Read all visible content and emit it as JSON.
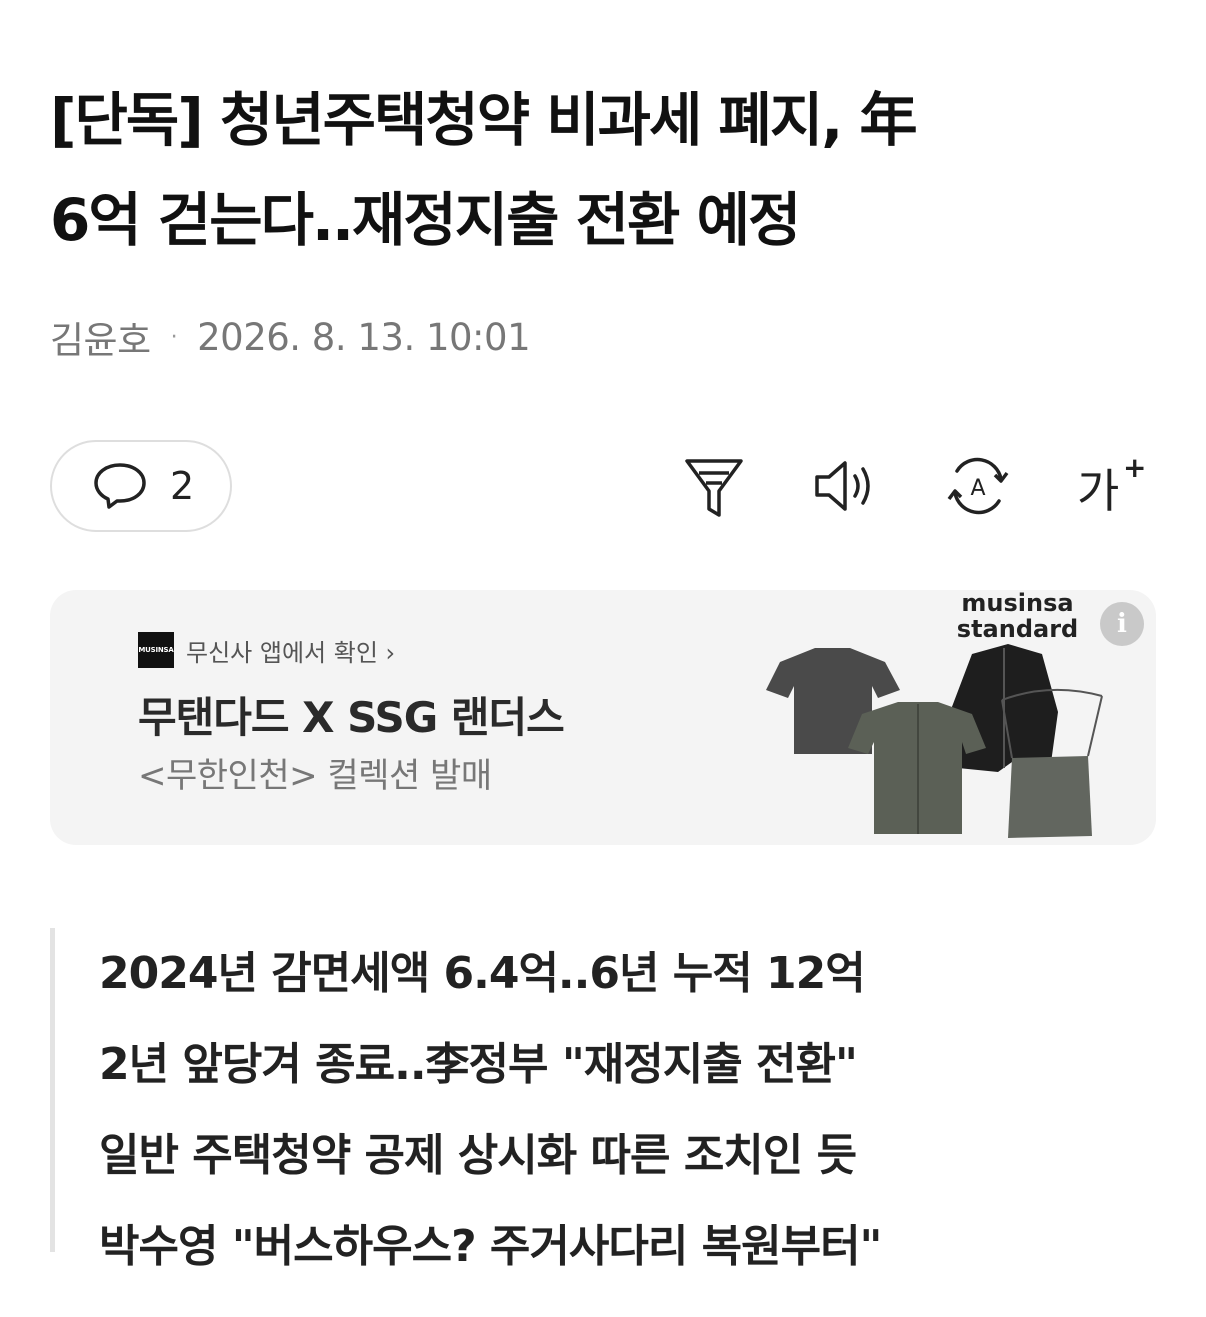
{
  "article": {
    "headline_line1": "[단독] 청년주택청약 비과세 폐지, 年",
    "headline_line2": "6억 걷는다..재정지출 전환 예정",
    "author": "김윤호",
    "separator": "·",
    "timestamp": "2026. 8. 13. 10:01"
  },
  "toolbar": {
    "comment_count": "2",
    "icons": [
      "comment-icon",
      "filter-icon",
      "speaker-icon",
      "translate-icon",
      "font-size-icon"
    ],
    "font_size_glyph": "가",
    "font_size_plus": "+"
  },
  "ad": {
    "logo_text": "MUSINSA",
    "source": "무신사 앱에서 확인 ›",
    "title": "무탠다드 X SSG 랜더스",
    "subtitle": "<무한인천> 컬렉션 발매",
    "brand_line1": "musinsa",
    "brand_line2": "standard",
    "info_glyph": "i"
  },
  "summary": {
    "lines": [
      "2024년 감면세액 6.4억..6년 누적 12억",
      "2년 앞당겨 종료..李정부 \"재정지출 전환\"",
      "일반 주택청약 공제 상시화 따른 조치인 듯",
      "박수영 \"버스하우스? 주거사다리 복원부터\""
    ]
  }
}
